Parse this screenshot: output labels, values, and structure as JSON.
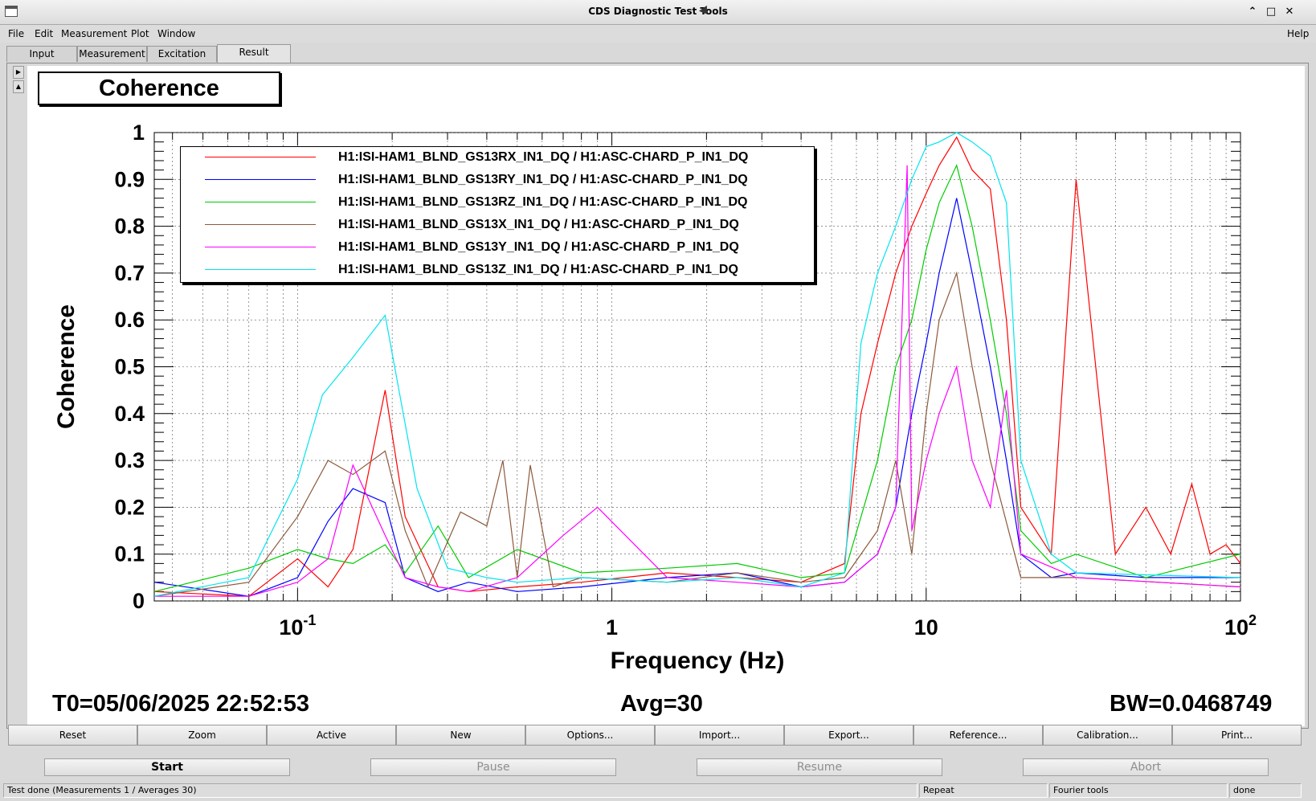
{
  "window": {
    "title": "CDS Diagnostic Test Tools",
    "buttons": [
      "minimize-icon",
      "maximize-icon",
      "close-icon"
    ]
  },
  "menu": {
    "items": [
      "File",
      "Edit",
      "Measurement",
      "Plot",
      "Window"
    ],
    "help": "Help"
  },
  "tabs": [
    {
      "label": "Input",
      "active": false
    },
    {
      "label": "Measurement",
      "active": false
    },
    {
      "label": "Excitation",
      "active": false
    },
    {
      "label": "Result",
      "active": true
    }
  ],
  "plot": {
    "title": "Coherence",
    "footer": {
      "t0": "T0=05/06/2025 22:52:53",
      "avg": "Avg=30",
      "bw": "BW=0.0468749"
    }
  },
  "chart_data": {
    "type": "line",
    "title": "Coherence",
    "xlabel": "Frequency (Hz)",
    "ylabel": "Coherence",
    "xscale": "log",
    "xlim": [
      0.035,
      100
    ],
    "ylim": [
      0,
      1
    ],
    "x_ticks": [
      "10^-1",
      "1",
      "10",
      "10^2"
    ],
    "y_ticks": [
      "0",
      "0.1",
      "0.2",
      "0.3",
      "0.4",
      "0.5",
      "0.6",
      "0.7",
      "0.8",
      "0.9",
      "1"
    ],
    "grid": true,
    "legend_position": "top-left",
    "series": [
      {
        "name": "H1:ISI-HAM1_BLND_GS13RX_IN1_DQ / H1:ASC-CHARD_P_IN1_DQ",
        "color": "#ff0000",
        "x": [
          0.035,
          0.07,
          0.1,
          0.125,
          0.15,
          0.19,
          0.22,
          0.28,
          0.35,
          0.5,
          0.8,
          1.5,
          2.5,
          4,
          5.5,
          6.2,
          7,
          8,
          9,
          10,
          11,
          12.5,
          14,
          16,
          18,
          20,
          25,
          30,
          40,
          50,
          60,
          70,
          80,
          90,
          100
        ],
        "y": [
          0.02,
          0.01,
          0.09,
          0.03,
          0.11,
          0.45,
          0.18,
          0.03,
          0.02,
          0.03,
          0.04,
          0.06,
          0.05,
          0.04,
          0.08,
          0.4,
          0.55,
          0.7,
          0.8,
          0.87,
          0.93,
          0.99,
          0.92,
          0.88,
          0.6,
          0.2,
          0.1,
          0.9,
          0.1,
          0.2,
          0.1,
          0.25,
          0.1,
          0.12,
          0.08
        ]
      },
      {
        "name": "H1:ISI-HAM1_BLND_GS13RY_IN1_DQ / H1:ASC-CHARD_P_IN1_DQ",
        "color": "#0000ff",
        "x": [
          0.035,
          0.07,
          0.1,
          0.125,
          0.15,
          0.19,
          0.22,
          0.28,
          0.35,
          0.5,
          0.8,
          1.5,
          2.5,
          4,
          5.5,
          7,
          8,
          9,
          10,
          11,
          12.5,
          14,
          16,
          18,
          20,
          25,
          30,
          50,
          100
        ],
        "y": [
          0.04,
          0.01,
          0.05,
          0.17,
          0.24,
          0.21,
          0.05,
          0.02,
          0.04,
          0.02,
          0.03,
          0.05,
          0.06,
          0.03,
          0.04,
          0.1,
          0.2,
          0.4,
          0.55,
          0.7,
          0.86,
          0.7,
          0.5,
          0.3,
          0.1,
          0.05,
          0.06,
          0.05,
          0.05
        ]
      },
      {
        "name": "H1:ISI-HAM1_BLND_GS13RZ_IN1_DQ / H1:ASC-CHARD_P_IN1_DQ",
        "color": "#00cc00",
        "x": [
          0.035,
          0.07,
          0.1,
          0.125,
          0.15,
          0.19,
          0.22,
          0.28,
          0.35,
          0.5,
          0.8,
          1.5,
          2.5,
          4,
          5.5,
          7,
          8,
          9,
          10,
          11,
          12.5,
          14,
          16,
          18,
          20,
          25,
          30,
          50,
          100
        ],
        "y": [
          0.02,
          0.07,
          0.11,
          0.09,
          0.08,
          0.12,
          0.06,
          0.16,
          0.05,
          0.11,
          0.06,
          0.07,
          0.08,
          0.05,
          0.06,
          0.3,
          0.5,
          0.6,
          0.75,
          0.85,
          0.93,
          0.8,
          0.6,
          0.4,
          0.15,
          0.08,
          0.1,
          0.05,
          0.1
        ]
      },
      {
        "name": "H1:ISI-HAM1_BLND_GS13X_IN1_DQ / H1:ASC-CHARD_P_IN1_DQ",
        "color": "#8b5a3c",
        "x": [
          0.035,
          0.07,
          0.1,
          0.125,
          0.15,
          0.19,
          0.22,
          0.26,
          0.33,
          0.4,
          0.45,
          0.5,
          0.55,
          0.65,
          0.8,
          1.5,
          2.5,
          4,
          5.5,
          7,
          8,
          9,
          10,
          11,
          12.5,
          14,
          16,
          20,
          30,
          100
        ],
        "y": [
          0.01,
          0.04,
          0.18,
          0.3,
          0.27,
          0.32,
          0.15,
          0.03,
          0.19,
          0.16,
          0.3,
          0.05,
          0.29,
          0.03,
          0.05,
          0.04,
          0.06,
          0.04,
          0.05,
          0.15,
          0.3,
          0.1,
          0.4,
          0.6,
          0.7,
          0.5,
          0.3,
          0.05,
          0.05,
          0.03
        ]
      },
      {
        "name": "H1:ISI-HAM1_BLND_GS13Y_IN1_DQ / H1:ASC-CHARD_P_IN1_DQ",
        "color": "#ff00ff",
        "x": [
          0.035,
          0.07,
          0.1,
          0.125,
          0.15,
          0.19,
          0.22,
          0.28,
          0.35,
          0.5,
          0.7,
          0.9,
          1.5,
          2.5,
          4,
          5.5,
          7,
          8,
          8.7,
          9,
          10,
          11,
          12.5,
          14,
          16,
          18,
          20,
          30,
          100
        ],
        "y": [
          0.01,
          0.01,
          0.04,
          0.09,
          0.29,
          0.14,
          0.05,
          0.03,
          0.02,
          0.05,
          0.14,
          0.2,
          0.05,
          0.04,
          0.03,
          0.04,
          0.1,
          0.2,
          0.93,
          0.15,
          0.3,
          0.4,
          0.5,
          0.3,
          0.2,
          0.45,
          0.1,
          0.05,
          0.03
        ]
      },
      {
        "name": "H1:ISI-HAM1_BLND_GS13Z_IN1_DQ / H1:ASC-CHARD_P_IN1_DQ",
        "color": "#00e5ee",
        "x": [
          0.035,
          0.07,
          0.1,
          0.12,
          0.15,
          0.19,
          0.24,
          0.3,
          0.4,
          0.5,
          0.8,
          1.5,
          2.5,
          4,
          5.5,
          6.2,
          7,
          8,
          9,
          10,
          11,
          12.5,
          14,
          16,
          18,
          20,
          25,
          30,
          100
        ],
        "y": [
          0.01,
          0.05,
          0.26,
          0.44,
          0.52,
          0.61,
          0.24,
          0.07,
          0.05,
          0.04,
          0.05,
          0.04,
          0.05,
          0.03,
          0.06,
          0.55,
          0.7,
          0.8,
          0.9,
          0.97,
          0.98,
          1.0,
          0.98,
          0.95,
          0.85,
          0.3,
          0.1,
          0.06,
          0.05
        ]
      }
    ]
  },
  "toolbar": [
    "Reset",
    "Zoom",
    "Active",
    "New",
    "Options...",
    "Import...",
    "Export...",
    "Reference...",
    "Calibration...",
    "Print..."
  ],
  "controls": {
    "start": "Start",
    "pause": "Pause",
    "resume": "Resume",
    "abort": "Abort"
  },
  "status": {
    "message": "Test done (Measurements 1 / Averages 30)",
    "repeat": "Repeat",
    "tools": "Fourier tools",
    "state": "done"
  }
}
